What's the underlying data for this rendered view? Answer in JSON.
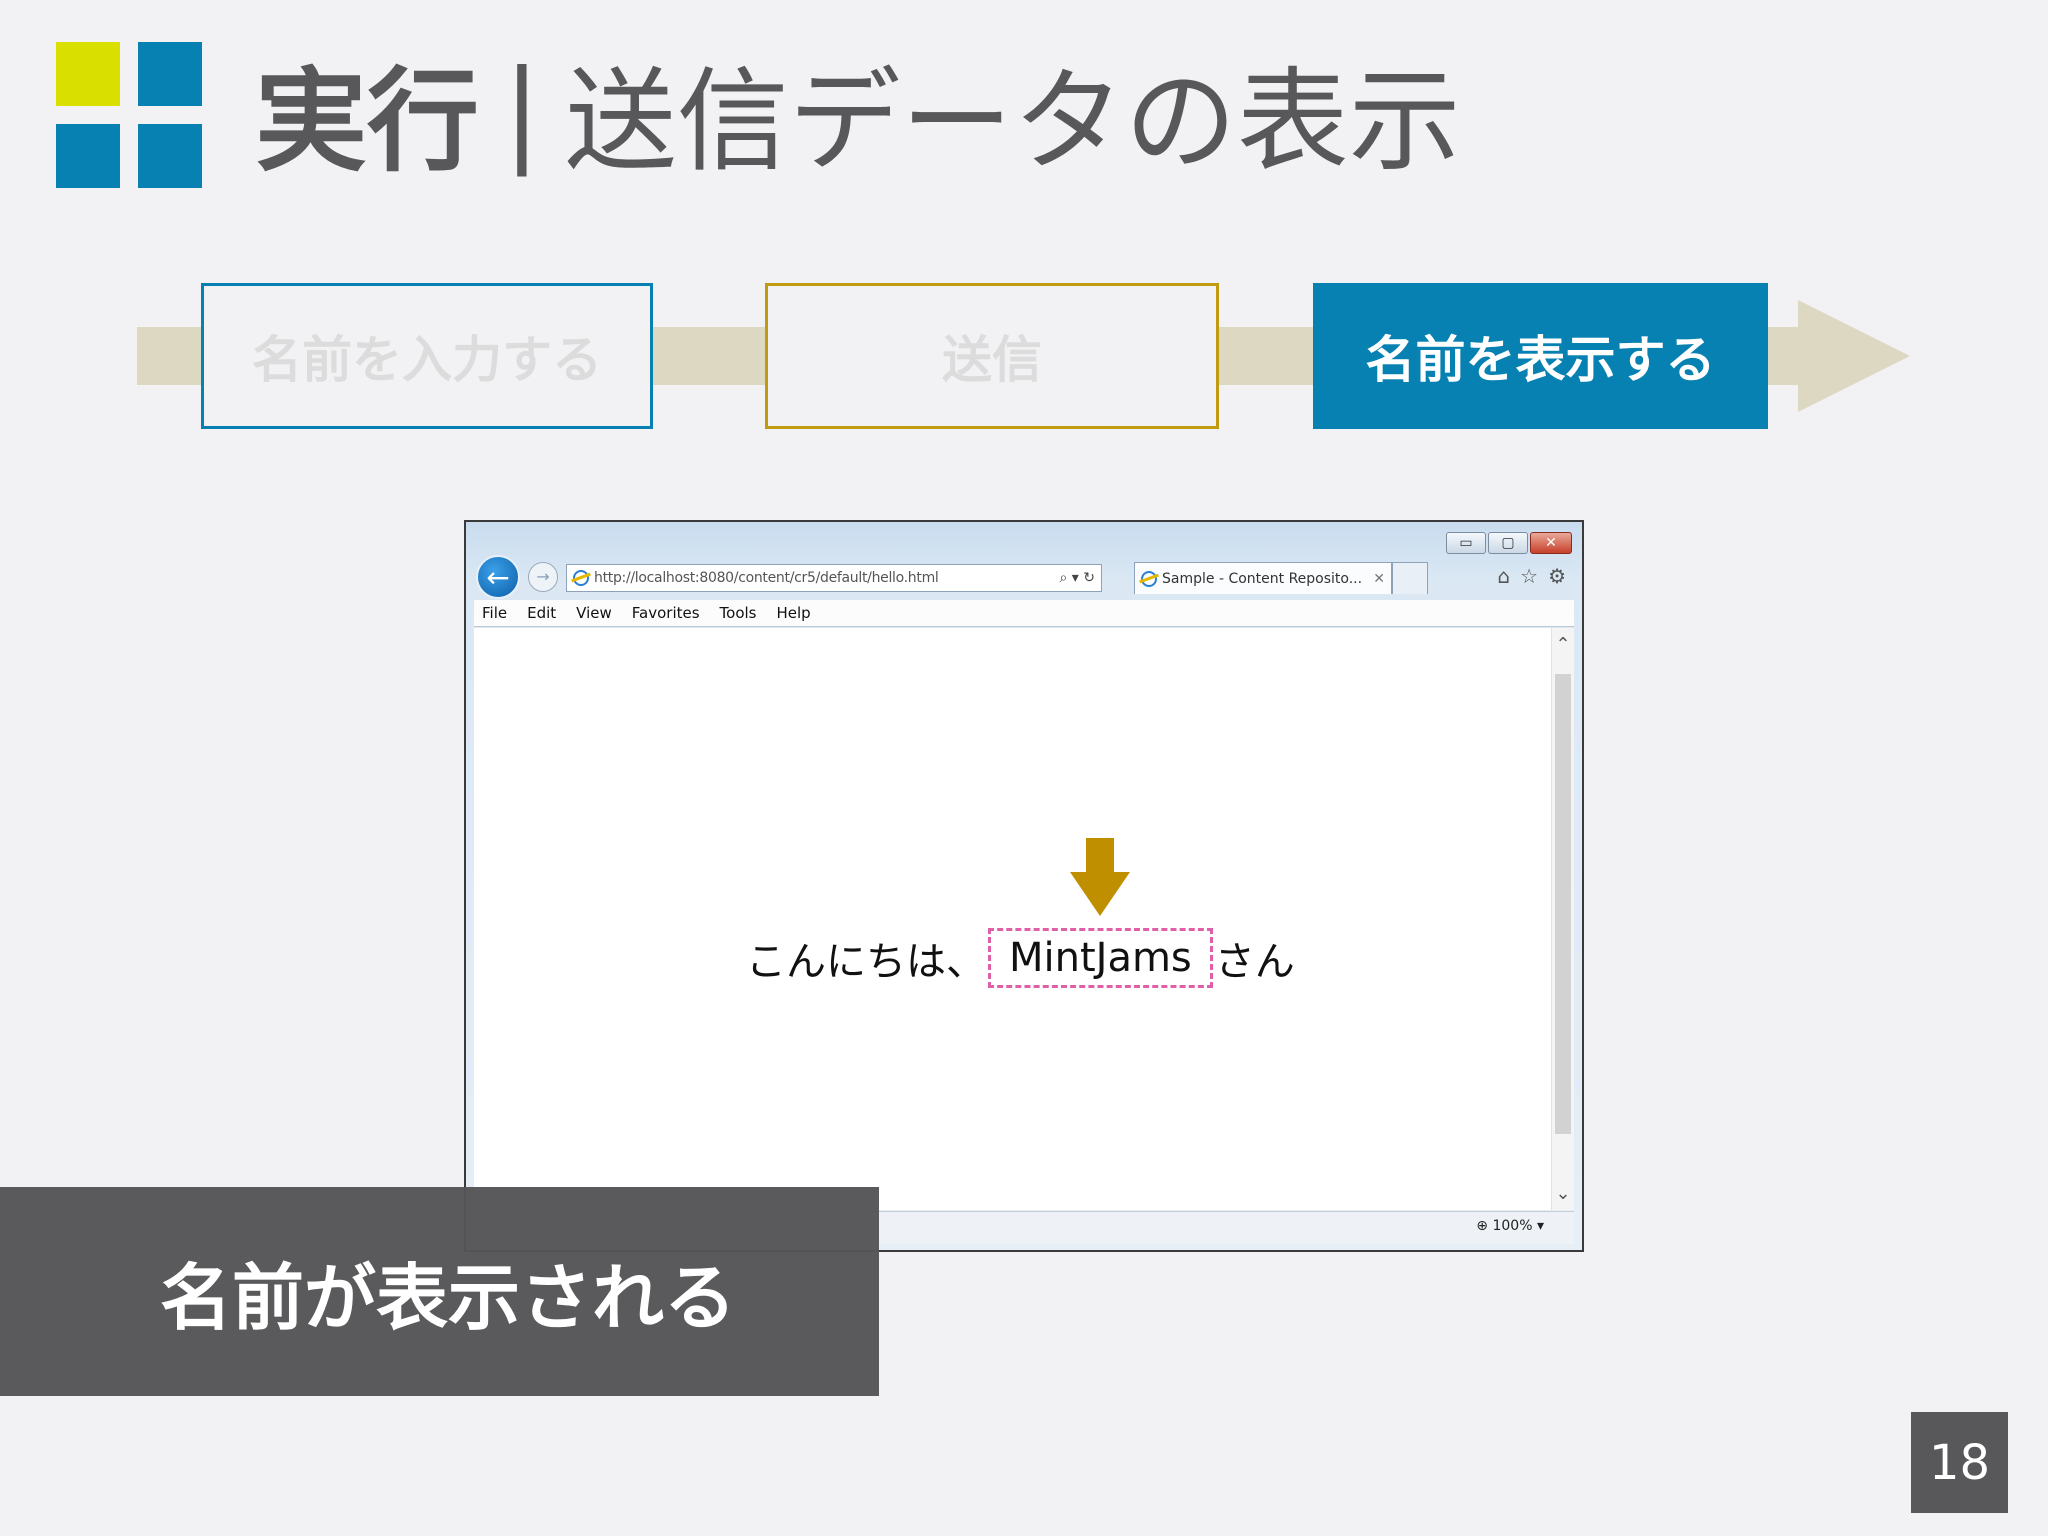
{
  "title": {
    "strong": "実行",
    "separator": "|",
    "rest": "送信データの表示"
  },
  "steps": [
    {
      "label": "名前を入力する"
    },
    {
      "label": "送信"
    },
    {
      "label": "名前を表示する"
    }
  ],
  "browser": {
    "url": "http://localhost:8080/content/cr5/default/hello.html",
    "tab_title": "Sample - Content Reposito...",
    "menu": [
      "File",
      "Edit",
      "View",
      "Favorites",
      "Tools",
      "Help"
    ],
    "greeting_prefix": "こんにちは、",
    "name": "MintJams",
    "greeting_suffix": "さん",
    "zoom": "100%"
  },
  "caption": "名前が表示される",
  "page_number": "18",
  "colors": {
    "accent_blue": "#0780b2",
    "accent_gold": "#c09a10",
    "yellow": "#d9e000",
    "dark_gray": "#58585a",
    "highlight_pink": "#e060a8"
  }
}
